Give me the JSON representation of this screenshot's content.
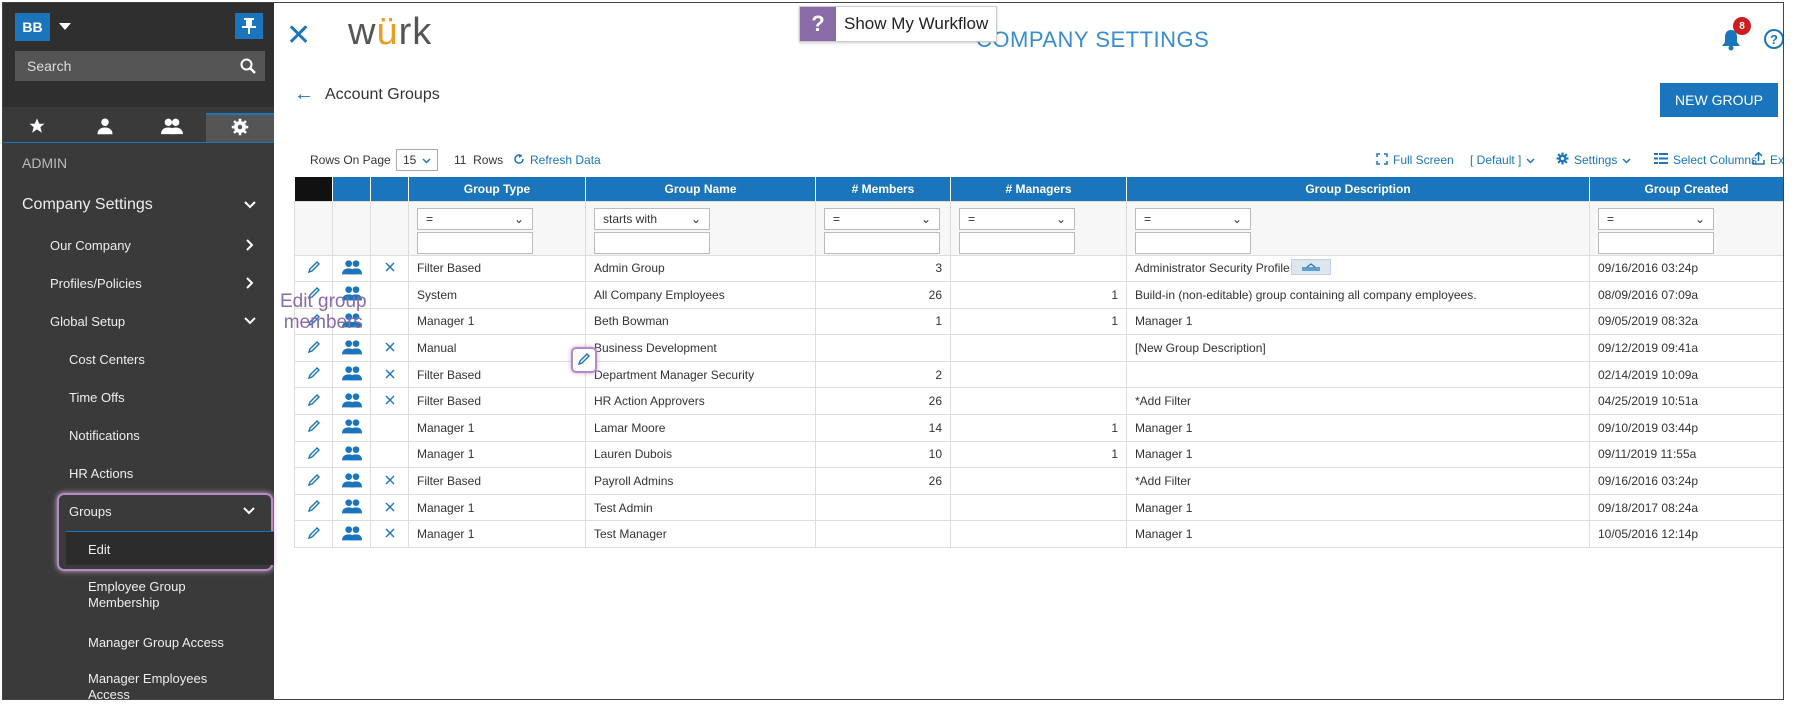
{
  "sidebar": {
    "avatar_initials": "BB",
    "search_placeholder": "Search",
    "section_label": "ADMIN",
    "menu": {
      "company_settings": "Company Settings",
      "our_company": "Our Company",
      "profiles_policies": "Profiles/Policies",
      "global_setup": "Global Setup",
      "cost_centers": "Cost Centers",
      "time_offs": "Time Offs",
      "notifications": "Notifications",
      "hr_actions": "HR Actions",
      "groups": "Groups",
      "edit": "Edit",
      "employee_group_membership": "Employee Group Membership",
      "manager_group_access": "Manager Group Access",
      "manager_employees_access": "Manager Employees Access"
    }
  },
  "header": {
    "logo_pre": "w",
    "logo_accent": "ü",
    "logo_post": "rk",
    "wurkflow_label": "Show My Wurkflow",
    "page_title": "COMPANY SETTINGS",
    "notification_count": "8",
    "help_glyph": "?"
  },
  "section": {
    "title": "Account Groups",
    "new_group_label": "NEW GROUP"
  },
  "toolbar": {
    "rows_on_page_label": "Rows On Page",
    "rows_on_page_value": "15",
    "rows_count": "11",
    "rows_label": "Rows",
    "refresh": "Refresh Data",
    "full_screen": "Full Screen",
    "view": "[ Default ]",
    "settings": "Settings",
    "select_columns": "Select Columns",
    "export": "Export"
  },
  "table": {
    "headers": [
      "Group Type",
      "Group Name",
      "# Members",
      "# Managers",
      "Group Description",
      "Group Created"
    ],
    "filters": [
      "=",
      "starts with",
      "=",
      "=",
      "=",
      "="
    ],
    "rows": [
      {
        "type": "Filter Based",
        "name": "Admin Group",
        "members": "3",
        "managers": "",
        "desc": "Administrator Security Profile",
        "created": "09/16/2016 03:24p",
        "deletable": true
      },
      {
        "type": "System",
        "name": "All Company Employees",
        "members": "26",
        "managers": "1",
        "desc": "Build-in (non-editable) group containing all company employees.",
        "created": "08/09/2016 07:09a",
        "deletable": false
      },
      {
        "type": "Manager 1",
        "name": "Beth Bowman",
        "members": "1",
        "managers": "1",
        "desc": "Manager 1",
        "created": "09/05/2019 08:32a",
        "deletable": false
      },
      {
        "type": "Manual",
        "name": "Business Development",
        "members": "",
        "managers": "",
        "desc": "[New Group Description]",
        "created": "09/12/2019 09:41a",
        "deletable": true
      },
      {
        "type": "Filter Based",
        "name": "Department Manager Security",
        "members": "2",
        "managers": "",
        "desc": "",
        "created": "02/14/2019 10:09a",
        "deletable": true
      },
      {
        "type": "Filter Based",
        "name": "HR Action Approvers",
        "members": "26",
        "managers": "",
        "desc": "*Add Filter",
        "created": "04/25/2019 10:51a",
        "deletable": true
      },
      {
        "type": "Manager 1",
        "name": "Lamar Moore",
        "members": "14",
        "managers": "1",
        "desc": "Manager 1",
        "created": "09/10/2019 03:44p",
        "deletable": false
      },
      {
        "type": "Manager 1",
        "name": "Lauren Dubois",
        "members": "10",
        "managers": "1",
        "desc": "Manager 1",
        "created": "09/11/2019 11:55a",
        "deletable": false
      },
      {
        "type": "Filter Based",
        "name": "Payroll Admins",
        "members": "26",
        "managers": "",
        "desc": "*Add Filter",
        "created": "09/16/2016 03:24p",
        "deletable": true
      },
      {
        "type": "Manager 1",
        "name": "Test Admin",
        "members": "",
        "managers": "",
        "desc": "Manager 1",
        "created": "09/18/2017 08:24a",
        "deletable": true
      },
      {
        "type": "Manager 1",
        "name": "Test Manager",
        "members": "",
        "managers": "",
        "desc": "Manager 1",
        "created": "10/05/2016 12:14p",
        "deletable": true
      }
    ]
  },
  "hint": {
    "line1": "Edit group",
    "line2": "members"
  },
  "colors": {
    "accent": "#1a75bc",
    "highlight": "#b58bc4",
    "sidebar_bg": "#3a3a3a",
    "badge": "#cc1e1e"
  }
}
